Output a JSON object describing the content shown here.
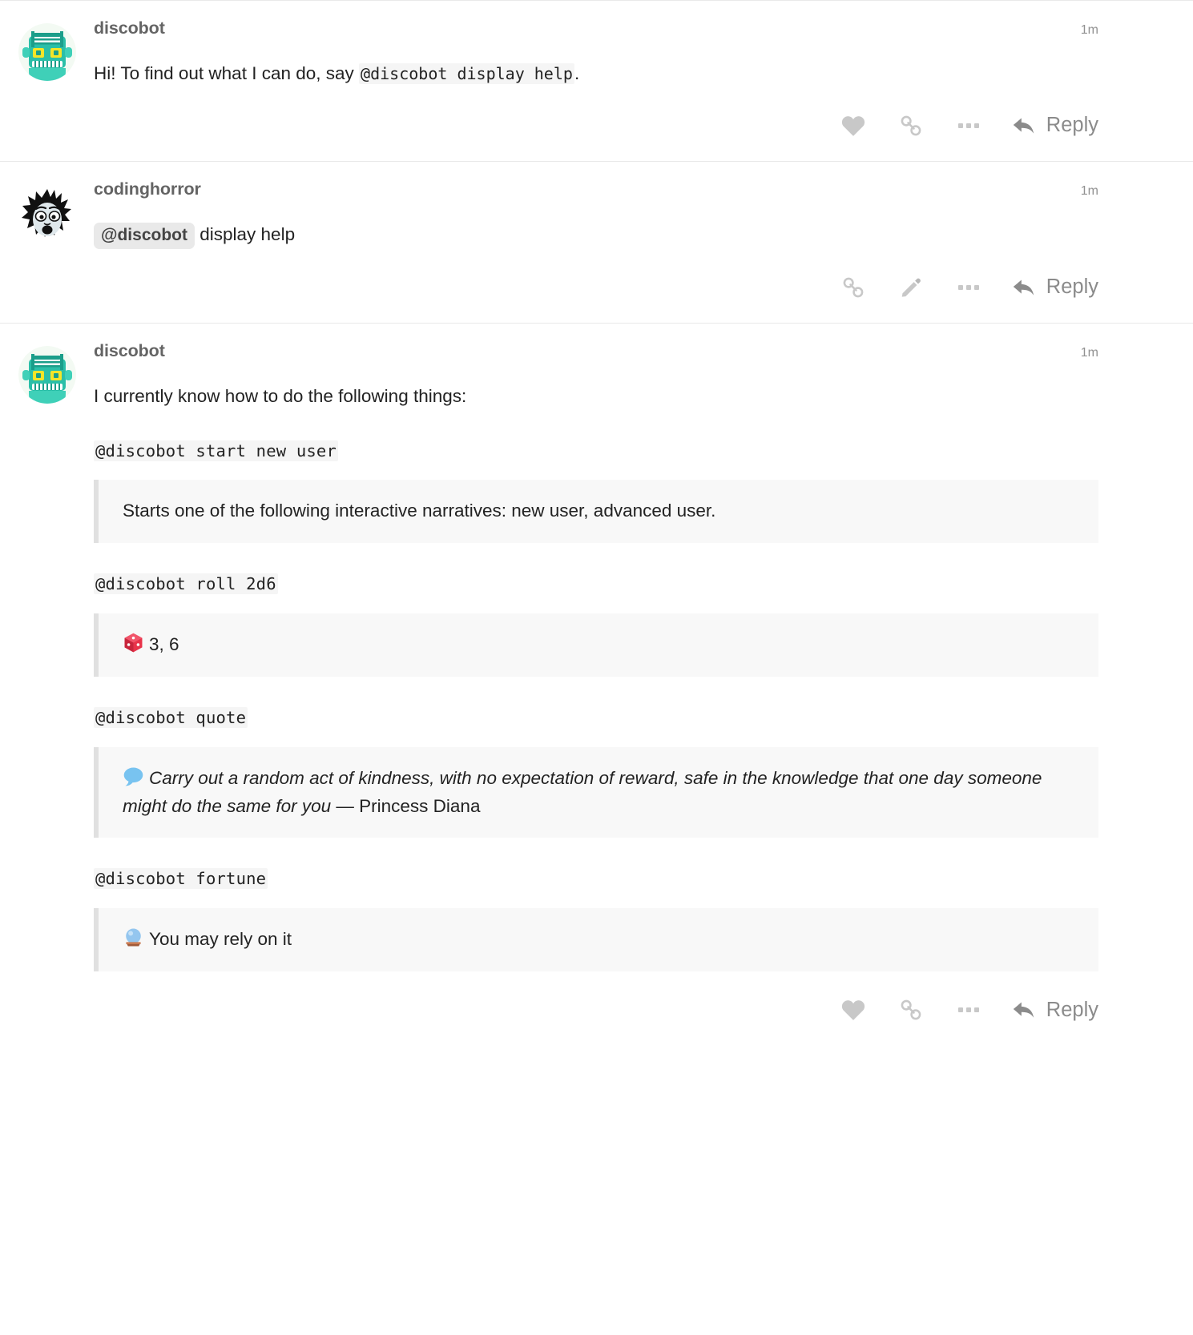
{
  "posts": [
    {
      "username": "discobot",
      "avatar": "discobot-robot-avatar",
      "date": "1m",
      "text_before_code": "Hi! To find out what I can do, say ",
      "code": "@discobot display help",
      "text_after_code": ".",
      "actions": {
        "like": "like-icon",
        "link": "link-icon",
        "more": "show-more-icon",
        "reply_label": "Reply"
      }
    },
    {
      "username": "codinghorror",
      "avatar": "codinghorror-face-avatar",
      "date": "1m",
      "mention": "@discobot",
      "mention_rest": "display help",
      "actions": {
        "link": "link-icon",
        "edit": "pencil-icon",
        "more": "show-more-icon",
        "reply_label": "Reply"
      }
    },
    {
      "username": "discobot",
      "avatar": "discobot-robot-avatar",
      "date": "1m",
      "intro": "I currently know how to do the following things:",
      "commands": [
        {
          "code": "@discobot start new user",
          "emoji": "",
          "result": "Starts one of the following interactive narratives: new user, advanced user.",
          "result_italic": "",
          "result_tail": ""
        },
        {
          "code": "@discobot roll 2d6",
          "emoji": "game-die-emoji",
          "result": "3, 6",
          "result_italic": "",
          "result_tail": ""
        },
        {
          "code": "@discobot quote",
          "emoji": "speech-balloon-emoji",
          "result": "",
          "result_italic": "Carry out a random act of kindness, with no expectation of reward, safe in the knowledge that one day someone might do the same for you",
          "result_tail": " — Princess Diana"
        },
        {
          "code": "@discobot fortune",
          "emoji": "crystal-ball-emoji",
          "result": "You may rely on it",
          "result_italic": "",
          "result_tail": ""
        }
      ],
      "actions": {
        "like": "like-icon",
        "link": "link-icon",
        "more": "show-more-icon",
        "reply_label": "Reply"
      }
    }
  ],
  "colors": {
    "code_bg": "#f5f5f5",
    "blockquote_bg": "#f8f8f8",
    "blockquote_border": "#e0e0e0",
    "mention_bg": "#e9e9e9",
    "icon_gray": "#c8c8c8",
    "username_gray": "#646464",
    "date_gray": "#919191"
  }
}
